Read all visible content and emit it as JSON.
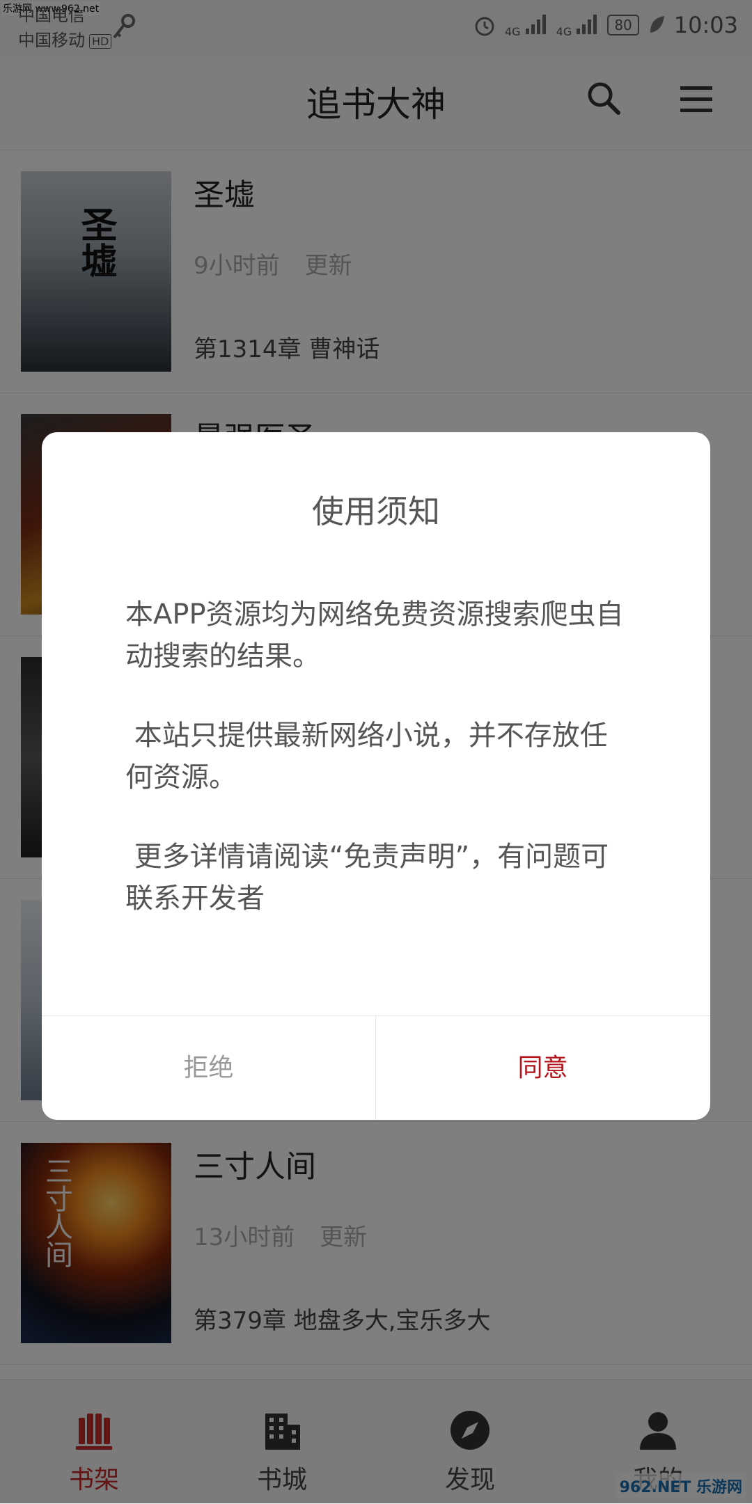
{
  "status_bar": {
    "watermark": "乐游网 www.962.net",
    "carrier_1": "中国电信",
    "carrier_2": "中国移动",
    "hd_badge": "HD",
    "signal_1": "4G",
    "signal_2": "4G",
    "battery": "80",
    "time": "10:03"
  },
  "header": {
    "title": "追书大神"
  },
  "books": [
    {
      "title": "圣墟",
      "time": "9小时前",
      "update": "更新",
      "chapter": "第1314章 曹神话",
      "cover_text": "圣墟"
    },
    {
      "title": "最强医圣",
      "time": "",
      "update": "",
      "chapter": "",
      "cover_text": ""
    },
    {
      "title": "",
      "time": "",
      "update": "",
      "chapter": "",
      "cover_text": ""
    },
    {
      "title": "",
      "time": "",
      "update": "",
      "chapter": "",
      "cover_text": ""
    },
    {
      "title": "三寸人间",
      "time": "13小时前",
      "update": "更新",
      "chapter": "第379章 地盘多大,宝乐多大",
      "cover_text": "三寸人间"
    }
  ],
  "bottom_nav": {
    "items": [
      {
        "label": "书架",
        "icon": "bookshelf-icon"
      },
      {
        "label": "书城",
        "icon": "building-icon"
      },
      {
        "label": "发现",
        "icon": "compass-icon"
      },
      {
        "label": "我的",
        "icon": "user-icon"
      }
    ],
    "watermark": "962.NET 乐游网"
  },
  "dialog": {
    "title": "使用须知",
    "paragraphs": [
      "本APP资源均为网络免费资源搜索爬虫自动搜索的结果。",
      " 本站只提供最新网络小说，并不存放任何资源。",
      " 更多详情请阅读“免责声明”，有问题可联系开发者"
    ],
    "refuse_label": "拒绝",
    "agree_label": "同意"
  },
  "colors": {
    "accent": "#c62828",
    "overlay": "#000000"
  }
}
